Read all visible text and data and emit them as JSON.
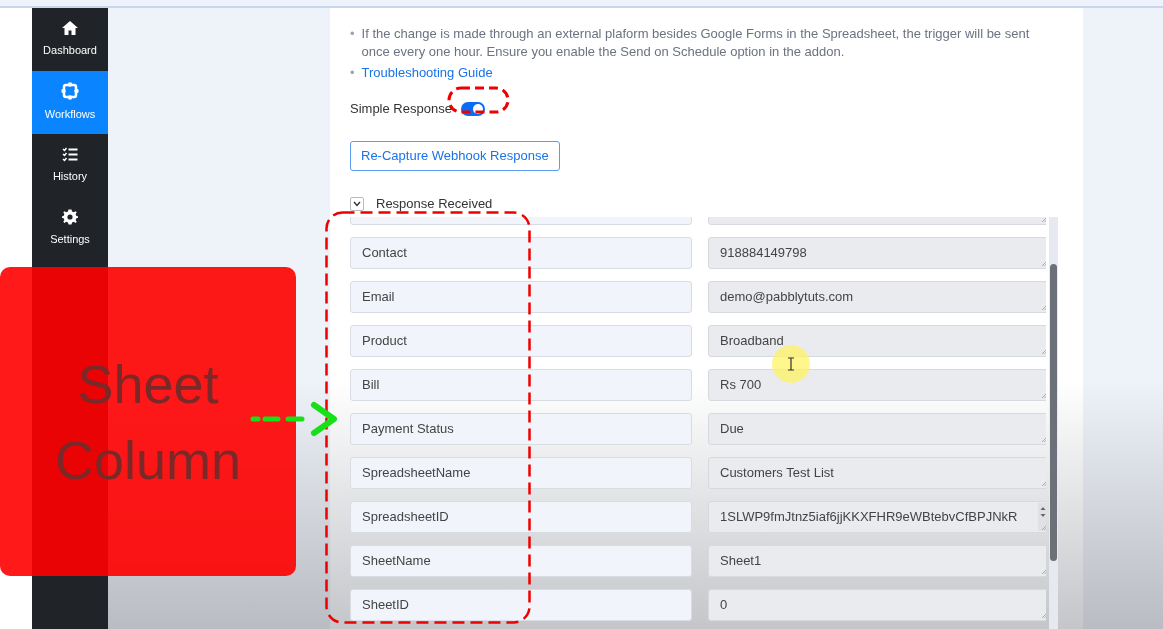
{
  "sidebar": {
    "items": [
      {
        "kind": "home",
        "label": "Dashboard",
        "selected": false
      },
      {
        "kind": "workflow",
        "label": "Workflows",
        "selected": true
      },
      {
        "kind": "list",
        "label": "History",
        "selected": false
      },
      {
        "kind": "gear",
        "label": "Settings",
        "selected": false
      }
    ]
  },
  "notes": [
    {
      "bullet": "•",
      "text": "If the change is made through an external plaform besides Google Forms in the Spreadsheet, the trigger will be sent once every one hour. Ensure you enable the Send on Schedule option in the addon."
    }
  ],
  "guide_link": {
    "bullet": "•",
    "text": "Troubleshooting Guide"
  },
  "simple_response": {
    "label": "Simple Response",
    "on": true
  },
  "recapture_button": "Re-Capture Webhook Response",
  "response_section": {
    "label": "Response Received",
    "expanded": true
  },
  "fields": [
    {
      "key": "Contact",
      "value": "918884149798",
      "overflow": false
    },
    {
      "key": "Email",
      "value": "demo@pabblytuts.com",
      "overflow": false
    },
    {
      "key": "Product",
      "value": "Broadband",
      "overflow": false
    },
    {
      "key": "Bill",
      "value": "Rs 700",
      "overflow": false
    },
    {
      "key": "Payment Status",
      "value": "Due",
      "overflow": false
    },
    {
      "key": "SpreadsheetName",
      "value": "Customers Test List",
      "overflow": false
    },
    {
      "key": "SpreadsheetID",
      "value": "1SLWP9fmJtnz5iaf6jjKKXFHR9eWBtebvCfBPJNkR",
      "overflow": true
    },
    {
      "key": "SheetName",
      "value": "Sheet1",
      "overflow": false
    },
    {
      "key": "SheetID",
      "value": "0",
      "overflow": false
    }
  ],
  "annotation": {
    "text": "Sheet Column"
  }
}
